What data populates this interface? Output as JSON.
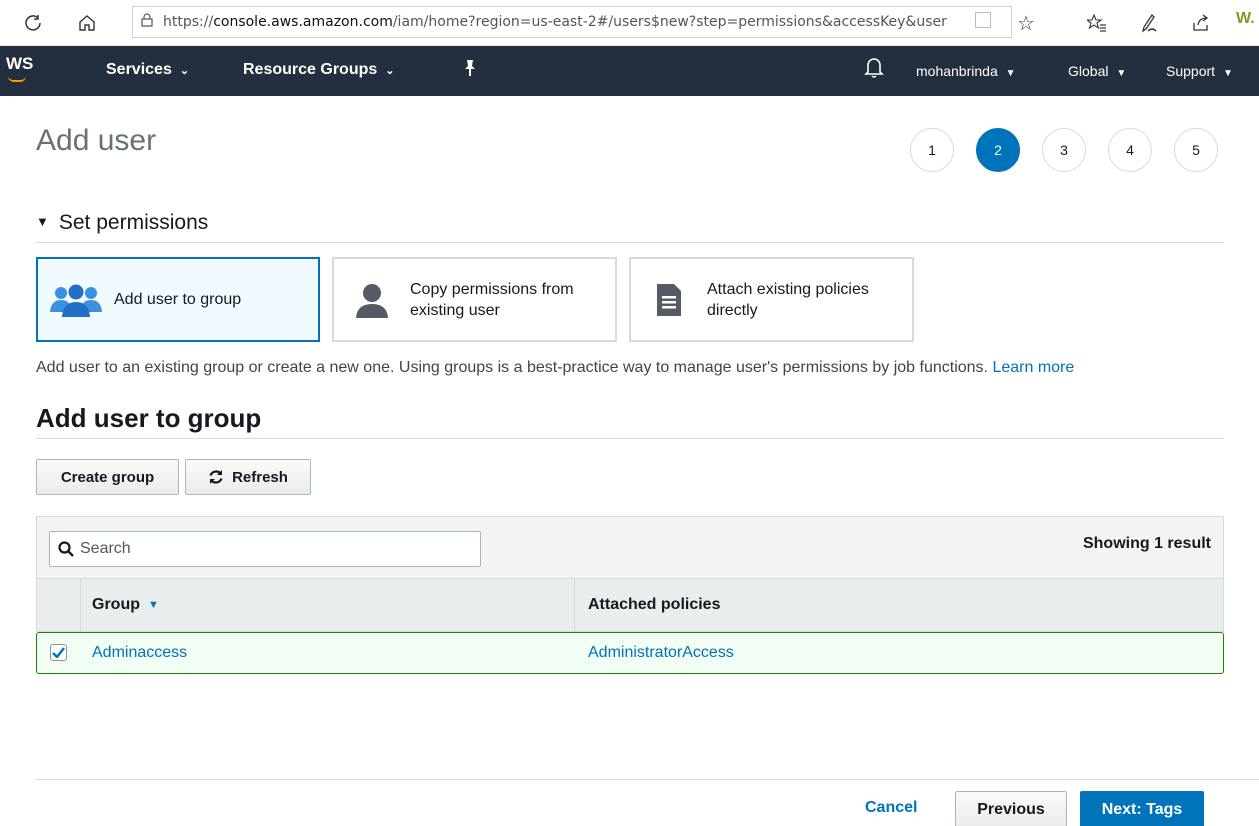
{
  "browser": {
    "url_prefix": "https://",
    "url_domain": "console.aws.amazon.com",
    "url_path": "/iam/home?region=us-east-2#/users$new?step=permissions&accessKey&user",
    "extension_badge": "W."
  },
  "nav": {
    "logo": "WS",
    "services": "Services",
    "resource_groups": "Resource Groups",
    "account": "mohanbrinda",
    "region": "Global",
    "support": "Support"
  },
  "page": {
    "title": "Add user",
    "steps": [
      "1",
      "2",
      "3",
      "4",
      "5"
    ],
    "active_step": 2
  },
  "permissions": {
    "heading": "Set permissions",
    "options": [
      {
        "label": "Add user to group",
        "selected": true
      },
      {
        "label_line1": "Copy permissions from",
        "label_line2": "existing user",
        "selected": false
      },
      {
        "label_line1": "Attach existing policies",
        "label_line2": "directly",
        "selected": false
      }
    ],
    "help": "Add user to an existing group or create a new one. Using groups is a best-practice way to manage user's permissions by job functions.",
    "learn_more": "Learn more"
  },
  "group_section": {
    "heading": "Add user to group",
    "create_group": "Create group",
    "refresh": "Refresh",
    "search_placeholder": "Search",
    "showing": "Showing 1 result",
    "columns": [
      "Group",
      "Attached policies"
    ],
    "rows": [
      {
        "group": "Adminaccess",
        "policies": "AdministratorAccess",
        "checked": true
      }
    ]
  },
  "footer": {
    "cancel": "Cancel",
    "previous": "Previous",
    "next": "Next: Tags"
  },
  "colors": {
    "nav_bg": "#232f3e",
    "accent": "#0073bb",
    "selected_row_border": "#1d8102"
  }
}
